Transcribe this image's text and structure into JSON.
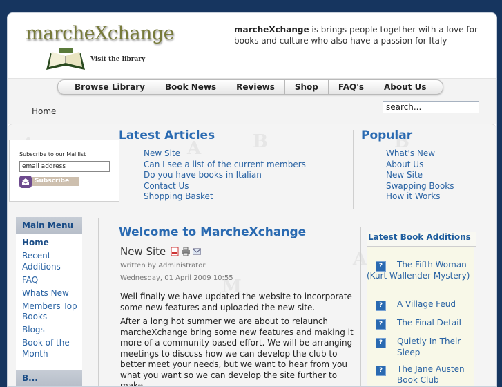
{
  "header": {
    "logo_text": "marcheXchange",
    "visit_library": "Visit the library",
    "tagline_brand": "marcheXchange",
    "tagline_rest": " is brings people together with a love for books and culture who also have a passion for Italy"
  },
  "nav": {
    "items": [
      "Browse Library",
      "Book News",
      "Reviews",
      "Shop",
      "FAQ's",
      "About Us"
    ]
  },
  "breadcrumb": "Home",
  "search": {
    "value": "search..."
  },
  "maillist": {
    "title": "Subscribe to our Maillist",
    "input_value": "email address",
    "button_label": "Subscribe"
  },
  "latest_articles": {
    "heading": "Latest Articles",
    "items": [
      "New Site",
      "Can I see a list of the current members",
      "Do you have books in Italian",
      "Contact Us",
      "Shopping Basket"
    ]
  },
  "popular": {
    "heading": "Popular",
    "items": [
      "What's New",
      "About Us",
      "New Site",
      "Swapping Books",
      "How it Works"
    ]
  },
  "main_menu": {
    "heading": "Main Menu",
    "items": [
      "Home",
      "Recent Additions",
      "FAQ",
      "Whats New",
      "Members Top Books",
      "Blogs",
      "Book of the Month"
    ],
    "next_heading": "B..."
  },
  "main": {
    "title": "Welcome to MarcheXchange",
    "article_title": "New Site",
    "author": "Written by Administrator",
    "date": "Wednesday, 01 April 2009 10:55",
    "para1": "Well finally we have updated the website to incorporate some new features and uploaded the new site.",
    "para2": "After a long hot summer we are about to relaunch marcheXchange  bring some new features and making it more of a community based effort.  We will be arranging meetings to discuss how we can develop the club to better meet your needs, but we want to hear from you what you want so we can develop the site further to make"
  },
  "latest_books": {
    "heading": "Latest Book Additions",
    "items": [
      "The Fifth Woman (Kurt Wallender Mystery)",
      "A Village Feud",
      "The Final Detail",
      "Quietly In Their Sleep",
      "The Jane Austen Book Club"
    ]
  },
  "colors": {
    "background": "#16355f",
    "link": "#2a63a3",
    "heading": "#2a6ab1",
    "logo": "#777a3a"
  }
}
